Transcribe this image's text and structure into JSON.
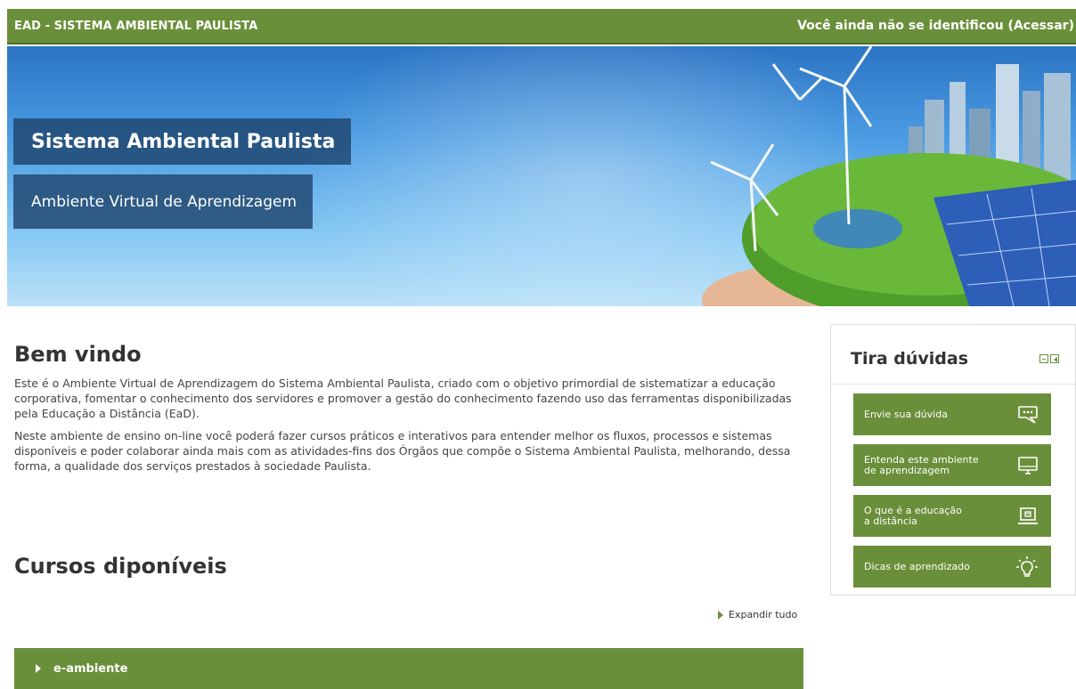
{
  "topbar": {
    "brand": "EAD - SISTEMA AMBIENTAL PAULISTA",
    "login_text": "Você ainda não se identificou (",
    "login_link": "Acessar",
    "login_close": ")"
  },
  "banner": {
    "title": "Sistema Ambiental Paulista",
    "subtitle": "Ambiente Virtual de Aprendizagem"
  },
  "main": {
    "welcome_heading": "Bem vindo",
    "paragraph1": "Este é o Ambiente Virtual de Aprendizagem do Sistema Ambiental Paulista, criado com o objetivo primordial de sistematizar a educação corporativa, fomentar o conhecimento dos servidores e promover a gestão do conhecimento fazendo uso das ferramentas disponibilizadas pela Educação a Distância (EaD).",
    "paragraph2": "Neste ambiente de ensino on-line você poderá fazer cursos práticos e interativos para entender melhor os fluxos, processos e sistemas disponíveis e poder colaborar ainda mais com as atividades-fins dos Órgãos que compõe o Sistema Ambiental Paulista, melhorando, dessa forma, a qualidade dos serviços prestados à sociedade Paulista.",
    "courses_heading": "Cursos diponíveis",
    "expand_all": "Expandir tudo",
    "course_category": "e-ambiente"
  },
  "sidebar": {
    "title": "Tira dúvidas",
    "buttons": [
      {
        "label": "Envie sua dúvida",
        "icon": "chat-bubble-icon"
      },
      {
        "label": "Entenda este ambiente\nde aprendizagem",
        "icon": "monitor-icon"
      },
      {
        "label": "O que é a educação\na distância",
        "icon": "laptop-icon"
      },
      {
        "label": "Dicas de aprendizado",
        "icon": "lightbulb-icon"
      }
    ]
  },
  "colors": {
    "accent_green": "#6a8f3a",
    "banner_box": "#1e466e"
  }
}
